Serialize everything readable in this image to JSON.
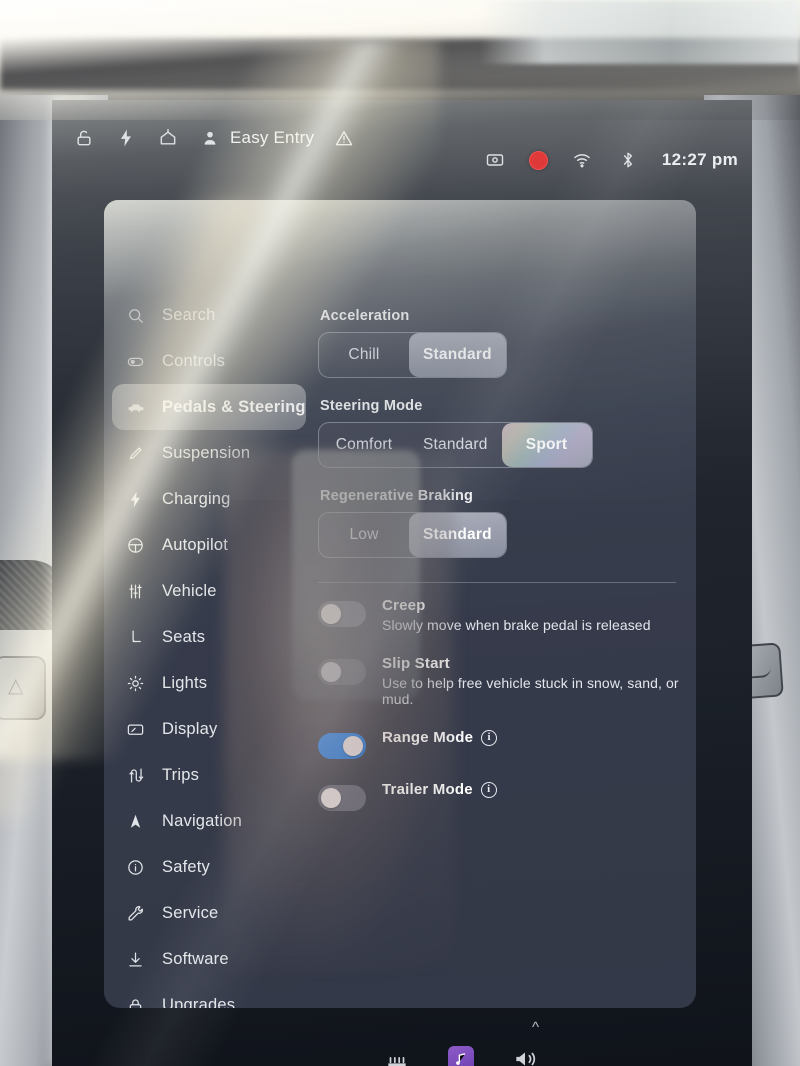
{
  "statusbar": {
    "left_icons": [
      "lock-icon",
      "lightning-bolt-icon",
      "home-icon"
    ],
    "profile_icon": "person-icon",
    "profile_label": "Easy Entry",
    "warning_icon": "warning-triangle-icon",
    "right_icons": [
      "dashcam-icon",
      "record-icon",
      "wifi-icon",
      "bluetooth-icon"
    ],
    "clock": "12:27 pm"
  },
  "sidebar": {
    "search_placeholder": "Search",
    "items": [
      {
        "label": "Search",
        "icon": "search-icon",
        "selected": false
      },
      {
        "label": "Controls",
        "icon": "toggle-icon",
        "selected": false
      },
      {
        "label": "Pedals & Steering",
        "icon": "car-icon",
        "selected": true
      },
      {
        "label": "Suspension",
        "icon": "shock-absorber-icon",
        "selected": false
      },
      {
        "label": "Charging",
        "icon": "lightning-bolt-icon",
        "selected": false
      },
      {
        "label": "Autopilot",
        "icon": "steering-wheel-icon",
        "selected": false
      },
      {
        "label": "Vehicle",
        "icon": "sliders-icon",
        "selected": false
      },
      {
        "label": "Seats",
        "icon": "seat-icon",
        "selected": false
      },
      {
        "label": "Lights",
        "icon": "brightness-icon",
        "selected": false
      },
      {
        "label": "Display",
        "icon": "screen-icon",
        "selected": false
      },
      {
        "label": "Trips",
        "icon": "route-icon",
        "selected": false
      },
      {
        "label": "Navigation",
        "icon": "navigation-arrow-icon",
        "selected": false
      },
      {
        "label": "Safety",
        "icon": "info-circle-icon",
        "selected": false
      },
      {
        "label": "Service",
        "icon": "wrench-icon",
        "selected": false
      },
      {
        "label": "Software",
        "icon": "download-icon",
        "selected": false
      },
      {
        "label": "Upgrades",
        "icon": "lock-icon",
        "selected": false
      }
    ]
  },
  "content": {
    "acceleration": {
      "title": "Acceleration",
      "options": [
        "Chill",
        "Standard"
      ],
      "selected": "Standard"
    },
    "steering_mode": {
      "title": "Steering Mode",
      "options": [
        "Comfort",
        "Standard",
        "Sport"
      ],
      "selected": "Sport"
    },
    "regenerative_braking": {
      "title": "Regenerative Braking",
      "options": [
        "Low",
        "Standard"
      ],
      "selected": "Standard"
    },
    "toggles": [
      {
        "title": "Creep",
        "subtitle": "Slowly move when brake pedal is released",
        "state": "off",
        "info": false
      },
      {
        "title": "Slip Start",
        "subtitle": "Use to help free vehicle stuck in snow, sand, or mud.",
        "state": "off",
        "info": false
      },
      {
        "title": "Range Mode",
        "subtitle": "",
        "state": "on",
        "info": true
      },
      {
        "title": "Trailer Mode",
        "subtitle": "",
        "state": "off",
        "info": true
      }
    ]
  },
  "dock": {
    "items": [
      "seats-icon",
      "media-player-icon",
      "chevron-up-icon",
      "volume-icon"
    ]
  },
  "colors": {
    "toggle_on": "#1a7ef0",
    "record_red": "#e03a3a",
    "panel_bg": "#3a4050",
    "selected_pill": "#bcbfc4",
    "text_primary": "#ffffff"
  }
}
